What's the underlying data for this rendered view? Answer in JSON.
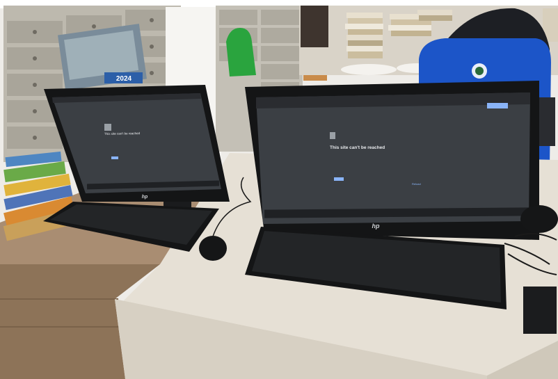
{
  "scene": {
    "calendar_year": "2024",
    "left_monitor": {
      "error_title": "This site can't be reached",
      "brand": "hp"
    },
    "right_monitor": {
      "error_title": "This site can't be reached",
      "reload_label": "Reload",
      "brand": "hp"
    }
  },
  "colors": {
    "wall": "#f2f1ee",
    "cabinet": "#b9b5aa",
    "desk_wood": "#a08469",
    "desk_white": "#e4ded3",
    "screen_bg": "#3b3f44",
    "chair_blue": "#1c55c8"
  }
}
